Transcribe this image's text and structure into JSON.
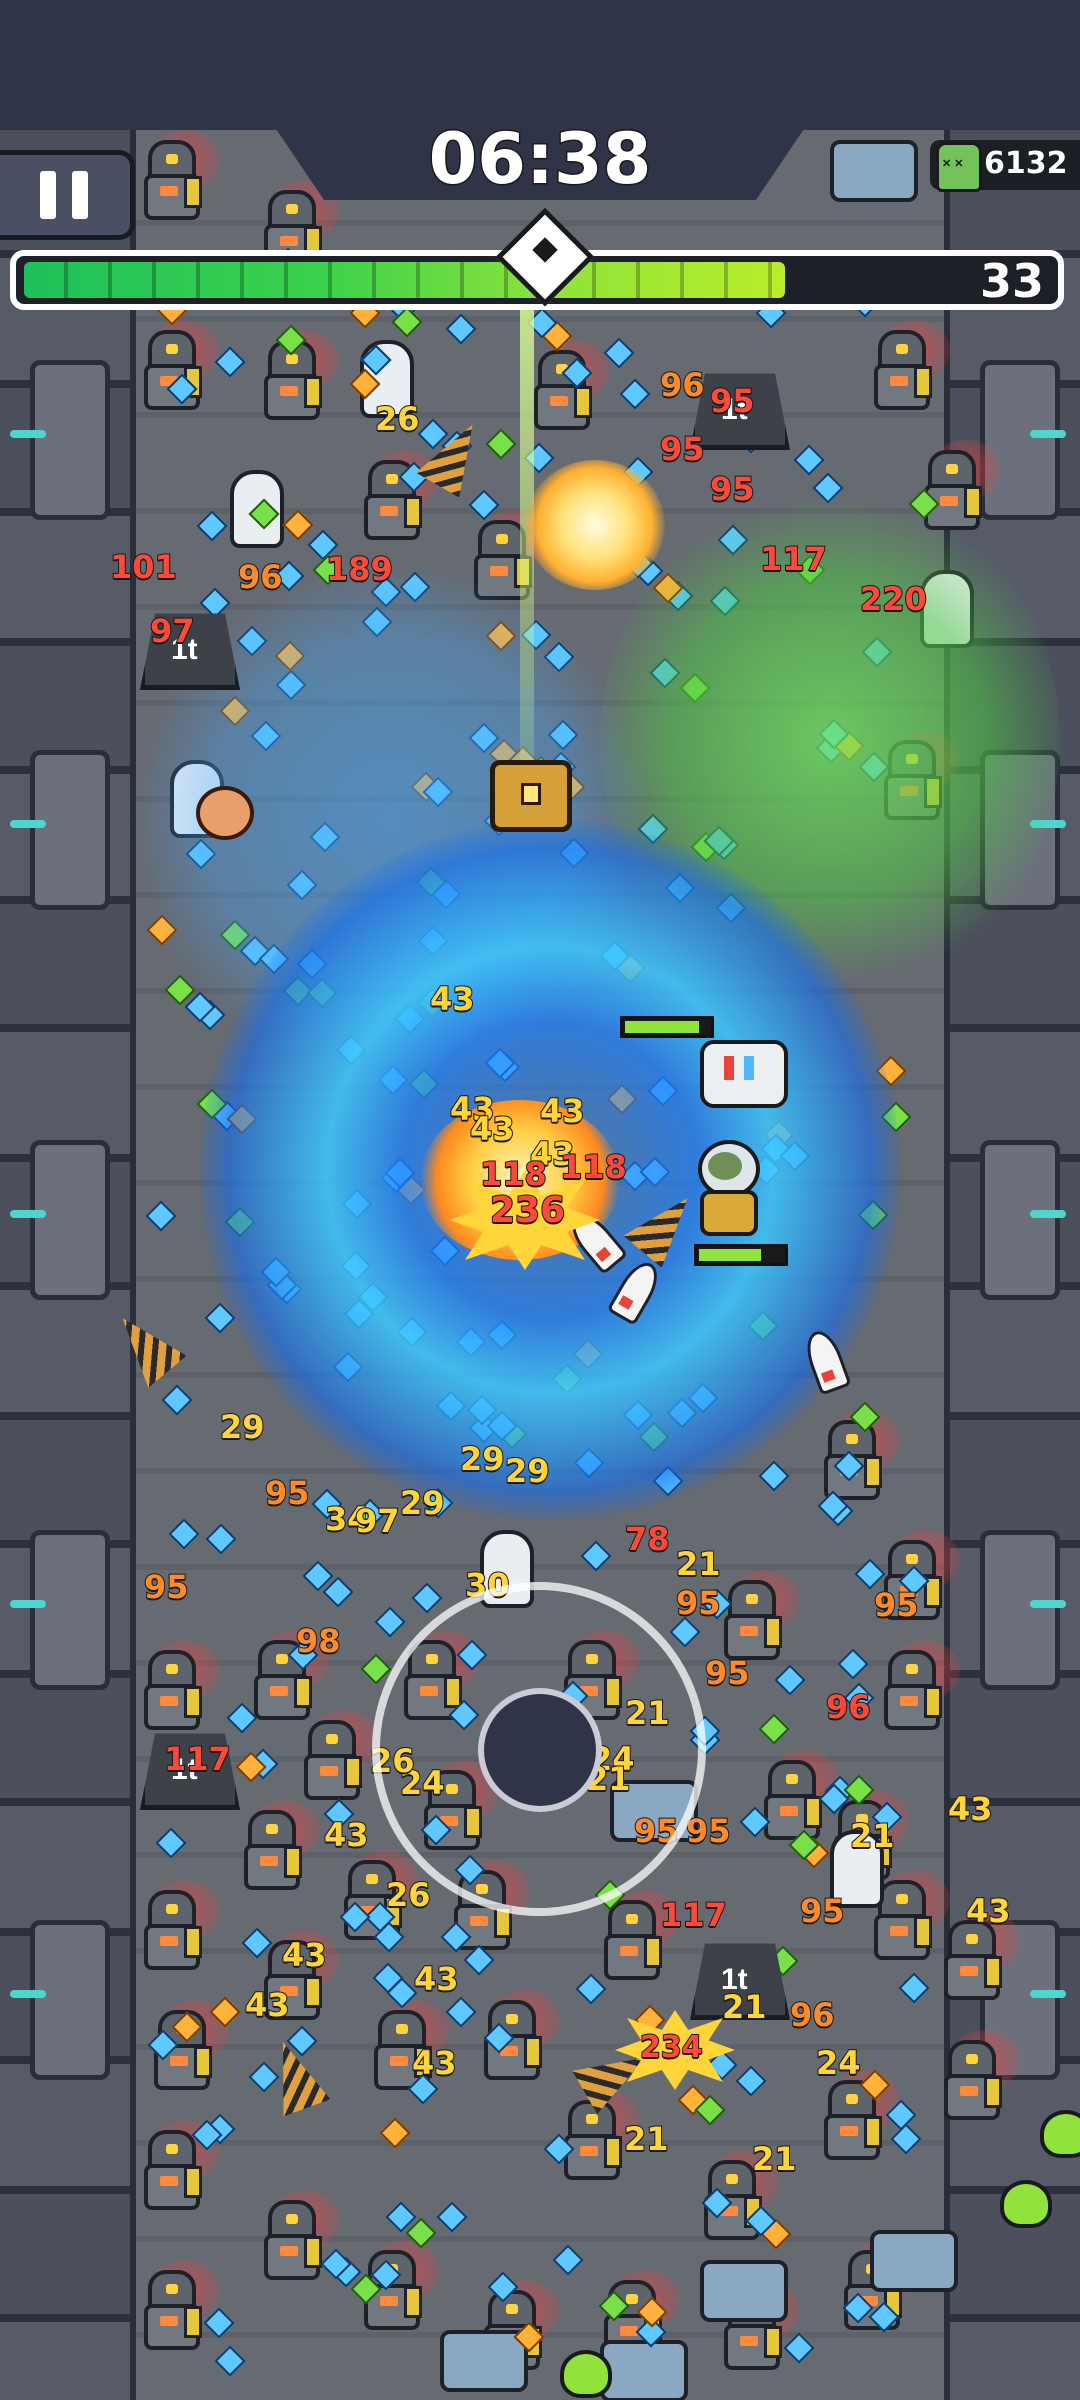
{
  "hud": {
    "timer": "06:38",
    "kill_count": "6132",
    "level": "33",
    "xp_fraction": 0.81,
    "pause_label": "Pause"
  },
  "player": {
    "hp_fraction": 0.75
  },
  "companion": {
    "hp_fraction": 0.9
  },
  "damage_numbers": [
    {
      "v": "26",
      "c": "y"
    },
    {
      "v": "96",
      "c": "o"
    },
    {
      "v": "95",
      "c": "r"
    },
    {
      "v": "95",
      "c": "r"
    },
    {
      "v": "95",
      "c": "r"
    },
    {
      "v": "101",
      "c": "r"
    },
    {
      "v": "96",
      "c": "o"
    },
    {
      "v": "189",
      "c": "r"
    },
    {
      "v": "117",
      "c": "r"
    },
    {
      "v": "220",
      "c": "r"
    },
    {
      "v": "97",
      "c": "r"
    },
    {
      "v": "43",
      "c": "y"
    },
    {
      "v": "43",
      "c": "y"
    },
    {
      "v": "43",
      "c": "y"
    },
    {
      "v": "43",
      "c": "y"
    },
    {
      "v": "43",
      "c": "y"
    },
    {
      "v": "118",
      "c": "r"
    },
    {
      "v": "118",
      "c": "r"
    },
    {
      "v": "29",
      "c": "y"
    },
    {
      "v": "95",
      "c": "o"
    },
    {
      "v": "34",
      "c": "y"
    },
    {
      "v": "97",
      "c": "y"
    },
    {
      "v": "29",
      "c": "y"
    },
    {
      "v": "29",
      "c": "y"
    },
    {
      "v": "29",
      "c": "y"
    },
    {
      "v": "78",
      "c": "r"
    },
    {
      "v": "21",
      "c": "y"
    },
    {
      "v": "95",
      "c": "o"
    },
    {
      "v": "95",
      "c": "o"
    },
    {
      "v": "30",
      "c": "y"
    },
    {
      "v": "98",
      "c": "o"
    },
    {
      "v": "95",
      "c": "o"
    },
    {
      "v": "95",
      "c": "o"
    },
    {
      "v": "96",
      "c": "r"
    },
    {
      "v": "21",
      "c": "y"
    },
    {
      "v": "24",
      "c": "y"
    },
    {
      "v": "117",
      "c": "r"
    },
    {
      "v": "21",
      "c": "y"
    },
    {
      "v": "95",
      "c": "o"
    },
    {
      "v": "95",
      "c": "o"
    },
    {
      "v": "43",
      "c": "y"
    },
    {
      "v": "21",
      "c": "y"
    },
    {
      "v": "43",
      "c": "y"
    },
    {
      "v": "43",
      "c": "y"
    },
    {
      "v": "95",
      "c": "o"
    },
    {
      "v": "26",
      "c": "y"
    },
    {
      "v": "43",
      "c": "y"
    },
    {
      "v": "117",
      "c": "r"
    },
    {
      "v": "43",
      "c": "y"
    },
    {
      "v": "43",
      "c": "y"
    },
    {
      "v": "21",
      "c": "y"
    },
    {
      "v": "96",
      "c": "o"
    },
    {
      "v": "24",
      "c": "y"
    },
    {
      "v": "43",
      "c": "y"
    },
    {
      "v": "21",
      "c": "y"
    },
    {
      "v": "21",
      "c": "y"
    },
    {
      "v": "24",
      "c": "y"
    },
    {
      "v": "26",
      "c": "y"
    }
  ],
  "crit_numbers": [
    {
      "v": "236"
    },
    {
      "v": "234"
    }
  ],
  "weight_label": "1t",
  "colors": {
    "xp_start": "#1fc05a",
    "xp_end": "#b8ee2a",
    "hp_fill": "#8fe33a",
    "damage_yellow": "#ffd53a",
    "damage_red": "#ff4a3a",
    "damage_orange": "#ff8a2a"
  }
}
